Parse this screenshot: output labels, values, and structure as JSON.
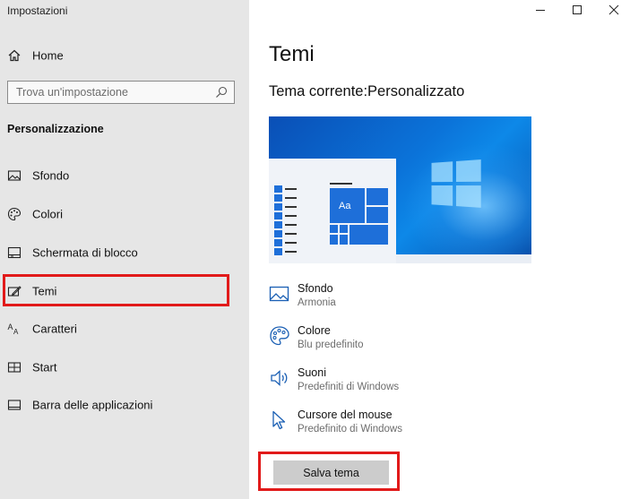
{
  "window": {
    "title": "Impostazioni",
    "controls": [
      "minimize",
      "maximize",
      "close"
    ]
  },
  "sidebar": {
    "home_label": "Home",
    "search_placeholder": "Trova un'impostazione",
    "section_title": "Personalizzazione",
    "items": [
      {
        "label": "Sfondo",
        "icon": "image-icon"
      },
      {
        "label": "Colori",
        "icon": "palette-icon"
      },
      {
        "label": "Schermata di blocco",
        "icon": "lock-screen-icon"
      },
      {
        "label": "Temi",
        "icon": "themes-icon",
        "selected": true
      },
      {
        "label": "Caratteri",
        "icon": "fonts-icon"
      },
      {
        "label": "Start",
        "icon": "start-icon"
      },
      {
        "label": "Barra delle applicazioni",
        "icon": "taskbar-icon"
      }
    ]
  },
  "main": {
    "title": "Temi",
    "current_theme_label": "Tema corrente:",
    "current_theme_value": "Personalizzato",
    "preview_tile_text": "Aa",
    "theme_items": [
      {
        "title": "Sfondo",
        "value": "Armonia",
        "icon": "image-icon"
      },
      {
        "title": "Colore",
        "value": "Blu predefinito",
        "icon": "palette-icon"
      },
      {
        "title": "Suoni",
        "value": "Predefiniti di Windows",
        "icon": "speaker-icon"
      },
      {
        "title": "Cursore del mouse",
        "value": "Predefinito di Windows",
        "icon": "cursor-icon"
      }
    ],
    "save_button": "Salva tema"
  },
  "colors": {
    "highlight": "#e11a1a",
    "accent": "#1e6fd9",
    "sidebar_bg": "#e6e6e6"
  }
}
